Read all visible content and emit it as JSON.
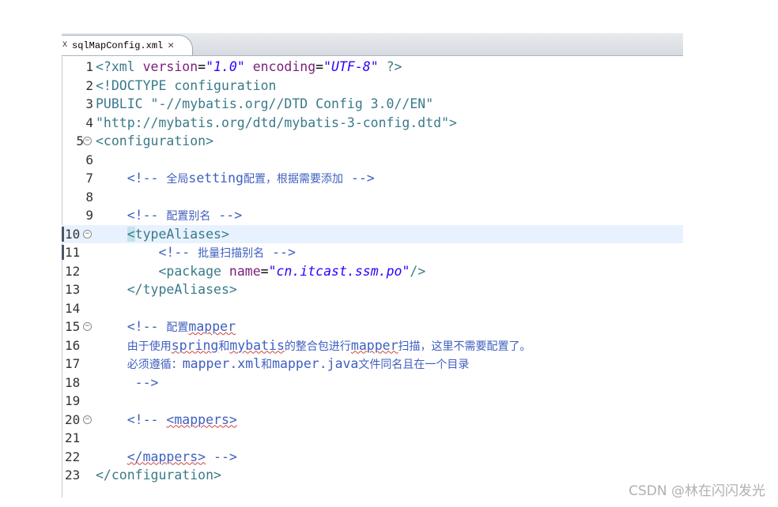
{
  "tab": {
    "filename": "sqlMapConfig.xml",
    "icon": "xml-file-icon",
    "close": "✕"
  },
  "lines": [
    {
      "n": "1"
    },
    {
      "n": "2"
    },
    {
      "n": "3"
    },
    {
      "n": "4"
    },
    {
      "n": "5"
    },
    {
      "n": "6"
    },
    {
      "n": "7"
    },
    {
      "n": "8"
    },
    {
      "n": "9"
    },
    {
      "n": "10"
    },
    {
      "n": "11"
    },
    {
      "n": "12"
    },
    {
      "n": "13"
    },
    {
      "n": "14"
    },
    {
      "n": "15"
    },
    {
      "n": "16"
    },
    {
      "n": "17"
    },
    {
      "n": "18"
    },
    {
      "n": "19"
    },
    {
      "n": "20"
    },
    {
      "n": "21"
    },
    {
      "n": "22"
    },
    {
      "n": "23"
    }
  ],
  "code": {
    "l1_a": "<?xml ",
    "l1_b": "version",
    "l1_c": "=",
    "l1_d": "\"1.0\"",
    "l1_e": " encoding",
    "l1_f": "=",
    "l1_g": "\"UTF-8\"",
    "l1_h": " ?>",
    "l2": "<!DOCTYPE configuration",
    "l3": "PUBLIC \"-//mybatis.org//DTD Config 3.0//EN\"",
    "l4": "\"http://mybatis.org/dtd/mybatis-3-config.dtd\">",
    "l5": "<configuration>",
    "l7_a": "    <!-- ",
    "l7_b": "全局",
    "l7_c": "setting",
    "l7_d": "配置，根据需要添加",
    "l7_e": " -->",
    "l9_a": "    <!-- ",
    "l9_b": "配置别名",
    "l9_c": " -->",
    "l10_a": "    ",
    "l10_b": "<",
    "l10_c": "typeAliases>",
    "l11_a": "        <!-- ",
    "l11_b": "批量扫描别名",
    "l11_c": " -->",
    "l12_a": "        <package ",
    "l12_b": "name",
    "l12_c": "=",
    "l12_d": "\"cn.itcast.ssm.po\"",
    "l12_e": "/>",
    "l13": "    </typeAliases>",
    "l15_a": "    <!-- ",
    "l15_b": "配置",
    "l15_c": "mapper",
    "l16_a": "    ",
    "l16_b": "由于使用",
    "l16_c": "spring",
    "l16_d": "和",
    "l16_e": "mybatis",
    "l16_f": "的整合包进行",
    "l16_g": "mapper",
    "l16_h": "扫描，这里不需要配置了。",
    "l17_a": "    ",
    "l17_b": "必须遵循：",
    "l17_c": "mapper.xml",
    "l17_d": "和",
    "l17_e": "mapper.java",
    "l17_f": "文件同名且在一个目录",
    "l18": "     -->",
    "l20_a": "    <!-- ",
    "l20_b": "<mappers>",
    "l22_a": "    ",
    "l22_b": "</mappers>",
    "l22_c": " -->",
    "l23": "</configuration>"
  },
  "watermark": "CSDN @林在闪闪发光",
  "colors": {
    "tag": "#3a7a8a",
    "attr": "#7a1f7a",
    "string": "#2a00ff",
    "comment": "#3f5fbf",
    "current_line": "#e8f2fe"
  }
}
